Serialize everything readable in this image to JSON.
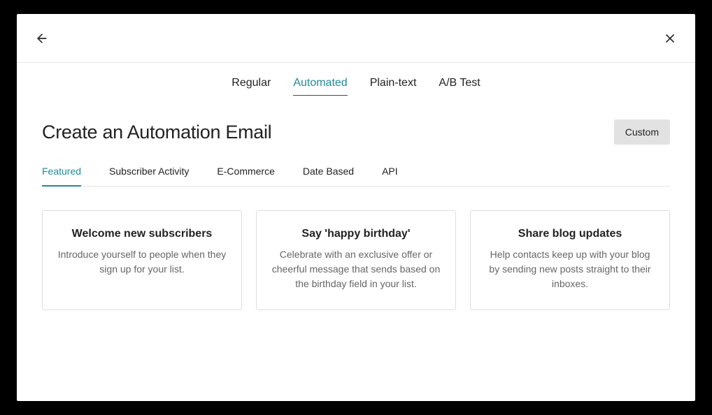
{
  "topTabs": [
    {
      "label": "Regular"
    },
    {
      "label": "Automated"
    },
    {
      "label": "Plain-text"
    },
    {
      "label": "A/B Test"
    }
  ],
  "heading": "Create an Automation Email",
  "customButton": "Custom",
  "subTabs": [
    {
      "label": "Featured"
    },
    {
      "label": "Subscriber Activity"
    },
    {
      "label": "E-Commerce"
    },
    {
      "label": "Date Based"
    },
    {
      "label": "API"
    }
  ],
  "cards": [
    {
      "title": "Welcome new subscribers",
      "desc": "Introduce yourself to people when they sign up for your list."
    },
    {
      "title": "Say 'happy birthday'",
      "desc": "Celebrate with an exclusive offer or cheerful message that sends based on the birthday field in your list."
    },
    {
      "title": "Share blog updates",
      "desc": "Help contacts keep up with your blog by sending new posts straight to their inboxes."
    }
  ]
}
